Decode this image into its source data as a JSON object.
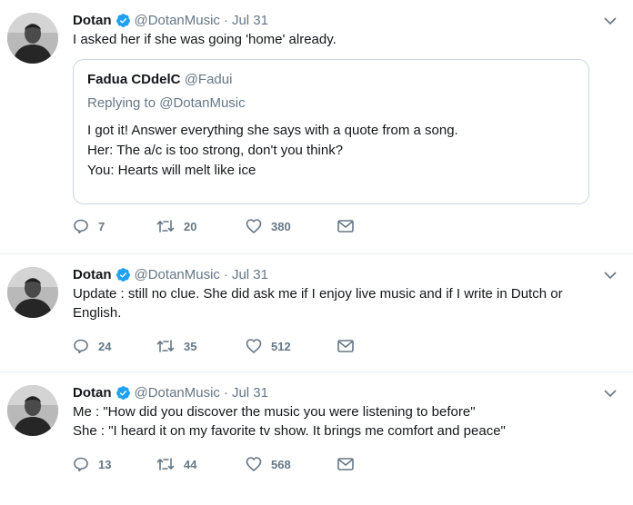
{
  "tweets": [
    {
      "author": "Dotan",
      "handle": "@DotanMusic",
      "separator": "·",
      "date": "Jul 31",
      "text": "I asked her if she was going 'home' already.",
      "quote": {
        "author": "Fadua CDdelC",
        "handle": "@Fadui",
        "replying_to": "Replying to @DotanMusic",
        "text": "I got it! Answer everything she says with a quote from a song.\nHer: The a/c is too strong, don't you think?\nYou: Hearts will melt like ice"
      },
      "replies": "7",
      "retweets": "20",
      "likes": "380"
    },
    {
      "author": "Dotan",
      "handle": "@DotanMusic",
      "separator": "·",
      "date": "Jul 31",
      "text": "Update : still no clue. She did ask me if I enjoy live music and if I write in Dutch or\nEnglish.",
      "replies": "24",
      "retweets": "35",
      "likes": "512"
    },
    {
      "author": "Dotan",
      "handle": "@DotanMusic",
      "separator": "·",
      "date": "Jul 31",
      "text": "Me : \"How did you discover the music you were listening to before\"\nShe : \"I heard it on my favorite tv show. It brings me comfort and peace\"",
      "replies": "13",
      "retweets": "44",
      "likes": "568"
    }
  ],
  "icons": {
    "verified": "verified-badge-icon",
    "caret": "chevron-down-icon",
    "reply": "reply-icon",
    "retweet": "retweet-icon",
    "like": "heart-icon",
    "dm": "envelope-icon"
  },
  "colors": {
    "verified": "#1da1f2",
    "text": "#14171a",
    "secondary": "#657786",
    "border": "#e6ecf0",
    "quote_border": "#ccd6dd"
  }
}
